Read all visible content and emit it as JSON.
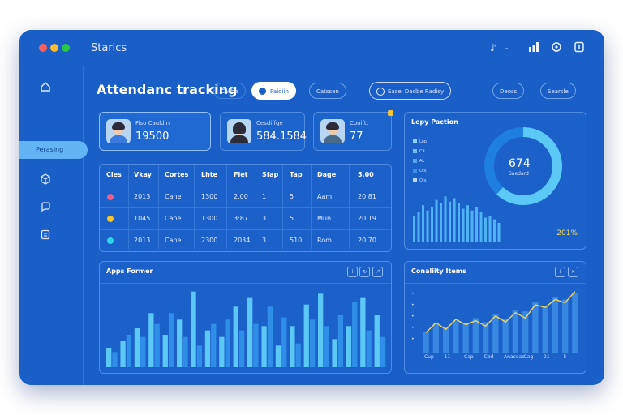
{
  "window": {
    "title": "Starics"
  },
  "titlebar_icons": [
    "audio-icon",
    "chevron-down-icon",
    "bar-chart-icon",
    "settings-icon",
    "document-icon"
  ],
  "sidebar": {
    "items": [
      {
        "icon": "home-icon"
      },
      {
        "label": "Perasing",
        "active": true
      },
      {
        "icon": "cube-icon"
      },
      {
        "icon": "chat-icon"
      },
      {
        "icon": "clipboard-icon"
      }
    ]
  },
  "page": {
    "title": "Attendanc tracking"
  },
  "filters": [
    {
      "label": "Cashe"
    },
    {
      "label": "Paidiin"
    },
    {
      "label": "Catssen"
    },
    {
      "label": "Easel Dadbe Radisy"
    },
    {
      "label": "Deoss"
    },
    {
      "label": "Searsle"
    }
  ],
  "stats": [
    {
      "label": "Fiso Cauldin",
      "value": "19500"
    },
    {
      "label": "Cesdiffge",
      "value": "584.1584"
    },
    {
      "label": "Coniftt",
      "value": "77"
    }
  ],
  "table": {
    "headers": [
      "Cles",
      "Vkay",
      "Cortes",
      "Lhte",
      "Flet",
      "Sfap",
      "Tap",
      "Dage",
      "5.00"
    ],
    "rows": [
      {
        "color": "#ec5f8a",
        "cells": [
          "2013",
          "Cane",
          "1300",
          "2.00",
          "1",
          "5",
          "Aam",
          "20.81"
        ]
      },
      {
        "color": "#f3c530",
        "cells": [
          "1045",
          "Cane",
          "1300",
          "3:87",
          "3",
          "5",
          "Mun",
          "20.19"
        ]
      },
      {
        "color": "#32d2ee",
        "cells": [
          "2013",
          "Cane",
          "2300",
          "2034",
          "3",
          "510",
          "Rom",
          "20.70"
        ]
      }
    ]
  },
  "donut_panel": {
    "title": "Lepy Paction",
    "center_value": "674",
    "center_label": "Saedard",
    "footer": "201%",
    "legend": [
      {
        "label": "Lep",
        "color": "#8fd3ff"
      },
      {
        "label": "Cit",
        "color": "#6fbdf5"
      },
      {
        "label": "Ak",
        "color": "#55a4ee"
      },
      {
        "label": "Ots",
        "color": "#3d8fe5"
      },
      {
        "label": "Ots",
        "color": "#b9d9ff"
      }
    ]
  },
  "bar_panel": {
    "title": "Apps Former"
  },
  "combo_panel": {
    "title": "Conaliity Items",
    "x_ticks": [
      "Cup",
      "11",
      "Cap",
      "Cod",
      "Anaceas",
      "Cag",
      "21",
      "5"
    ]
  },
  "colors": {
    "window_bg": "#1a5ec8",
    "accent": "#63b4f5",
    "line": "#f2d65a"
  },
  "chart_data": [
    {
      "type": "bar",
      "title": "Apps Former",
      "series": [
        {
          "values": [
            18,
            24,
            36,
            50,
            30,
            44,
            70,
            34,
            28,
            56,
            64,
            38,
            20,
            38,
            58,
            68,
            26,
            38,
            64,
            48
          ]
        },
        {
          "values": [
            14,
            30,
            28,
            40,
            50,
            28,
            20,
            40,
            44,
            34,
            40,
            56,
            46,
            22,
            44,
            38,
            48,
            60,
            34,
            28
          ]
        }
      ]
    },
    {
      "type": "bar",
      "title": "Lepy Paction",
      "values": [
        30,
        34,
        42,
        36,
        40,
        48,
        44,
        52,
        46,
        50,
        44,
        38,
        42,
        36,
        40,
        34,
        28,
        30,
        26,
        22
      ]
    },
    {
      "type": "line",
      "title": "Conaliity Items",
      "categories": [
        "Cup",
        "11",
        "Cap",
        "Cod",
        "Anaceas",
        "Cag",
        "21",
        "5"
      ],
      "series": [
        {
          "values": [
            30,
            45,
            35,
            50,
            42,
            48,
            40,
            55,
            46,
            60,
            52,
            72,
            68,
            80,
            75,
            92
          ]
        },
        {
          "values": [
            32,
            44,
            38,
            48,
            44,
            52,
            46,
            58,
            50,
            64,
            62,
            76,
            70,
            84,
            80,
            90
          ]
        }
      ]
    },
    {
      "type": "pie",
      "title": "Lepy Paction",
      "values": [
        62,
        38
      ]
    }
  ]
}
